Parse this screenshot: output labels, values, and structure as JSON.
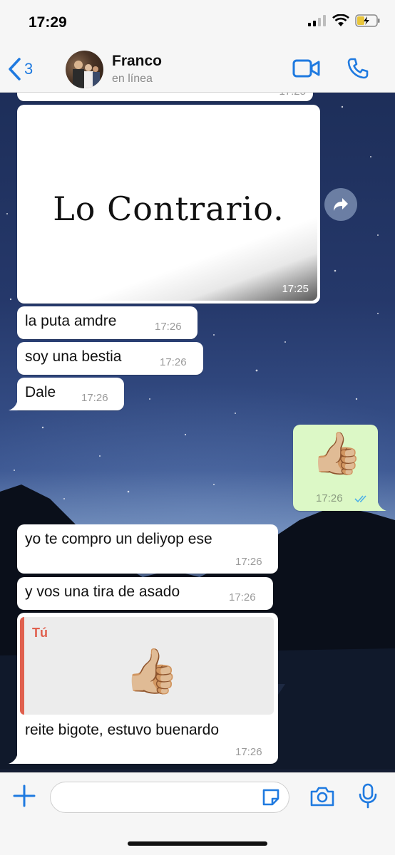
{
  "status_bar": {
    "time": "17:29"
  },
  "header": {
    "back_count": "3",
    "contact_name": "Franco",
    "contact_status": "en línea"
  },
  "messages": {
    "partial_top_time": "17:25",
    "image_text": "Lo Contrario.",
    "image_time": "17:25",
    "m1": {
      "text": "la puta amdre",
      "time": "17:26"
    },
    "m2": {
      "text": "soy una bestia",
      "time": "17:26"
    },
    "m3": {
      "text": "Dale",
      "time": "17:26"
    },
    "out1": {
      "emoji": "👍🏼",
      "time": "17:26"
    },
    "m4": {
      "text": "yo te compro un deliyop ese",
      "time": "17:26"
    },
    "m5": {
      "text": "y vos una tira de asado",
      "time": "17:26"
    },
    "m6": {
      "quote_author": "Tú",
      "quote_emoji": "👍🏼",
      "text": "reite bigote, estuvo buenardo",
      "time": "17:26"
    }
  },
  "input": {
    "placeholder": "",
    "value": ""
  },
  "colors": {
    "accent": "#1f7ae0",
    "outgoing_bubble": "#dcf8c6",
    "incoming_bubble": "#ffffff",
    "quote_accent": "#e0604e",
    "read_ticks": "#4fb1e8"
  },
  "icons": {
    "back": "chevron-left-icon",
    "video": "video-camera-icon",
    "call": "phone-icon",
    "forward": "forward-arrow-icon",
    "plus": "plus-icon",
    "sticker": "sticker-icon",
    "camera": "camera-icon",
    "mic": "microphone-icon"
  }
}
